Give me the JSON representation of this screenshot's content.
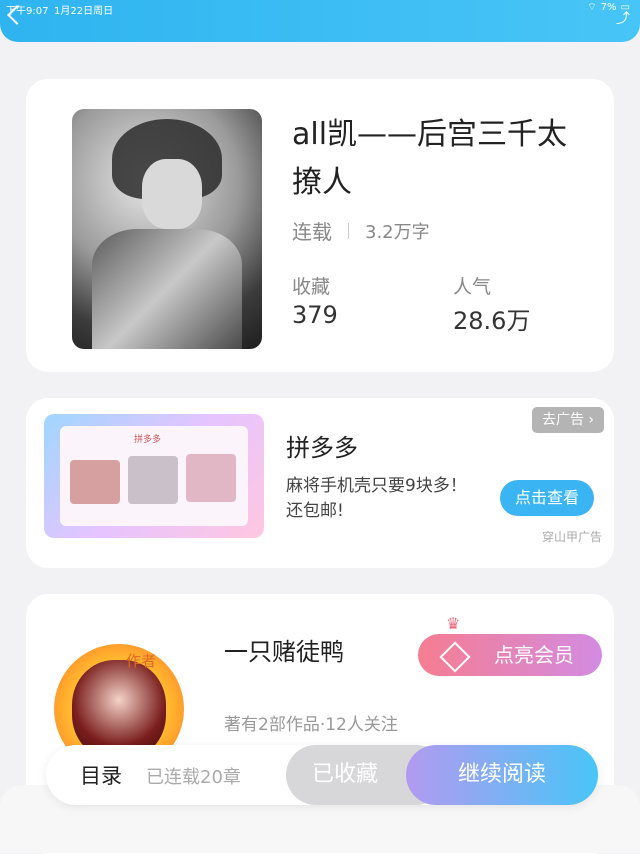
{
  "status_bar": {
    "time": "下午9:07",
    "date": "1月22日周日",
    "battery": "7%"
  },
  "book": {
    "title": "all凯——后宫三千太撩人",
    "status": "连载",
    "word_count": "3.2万字",
    "favorites_label": "收藏",
    "favorites_value": "379",
    "popularity_label": "人气",
    "popularity_value": "28.6万"
  },
  "ad": {
    "image_title": "拼多多",
    "title": "拼多多",
    "text": "麻将手机壳只要9块多！还包邮!",
    "button_label": "点击查看",
    "tag_label": "去广告 ›",
    "source": "穿山甲广告"
  },
  "author": {
    "avatar_tag": "作者",
    "name": "一只赌徒鸭",
    "info": "著有2部作品·12人关注",
    "vip_button_label": "点亮会员"
  },
  "bottom_bar": {
    "toc_label": "目录",
    "serial_label": "已连载20章",
    "collected_label": "已收藏",
    "continue_label": "继续阅读"
  },
  "colors": {
    "accent": "#3ab4f3",
    "vip_start": "#f57d90",
    "vip_end": "#d38be2",
    "header": "#2fb4f0"
  },
  "icons": [
    "back-icon",
    "share-icon",
    "wifi-icon",
    "battery-icon",
    "diamond-icon",
    "crown-icon"
  ]
}
